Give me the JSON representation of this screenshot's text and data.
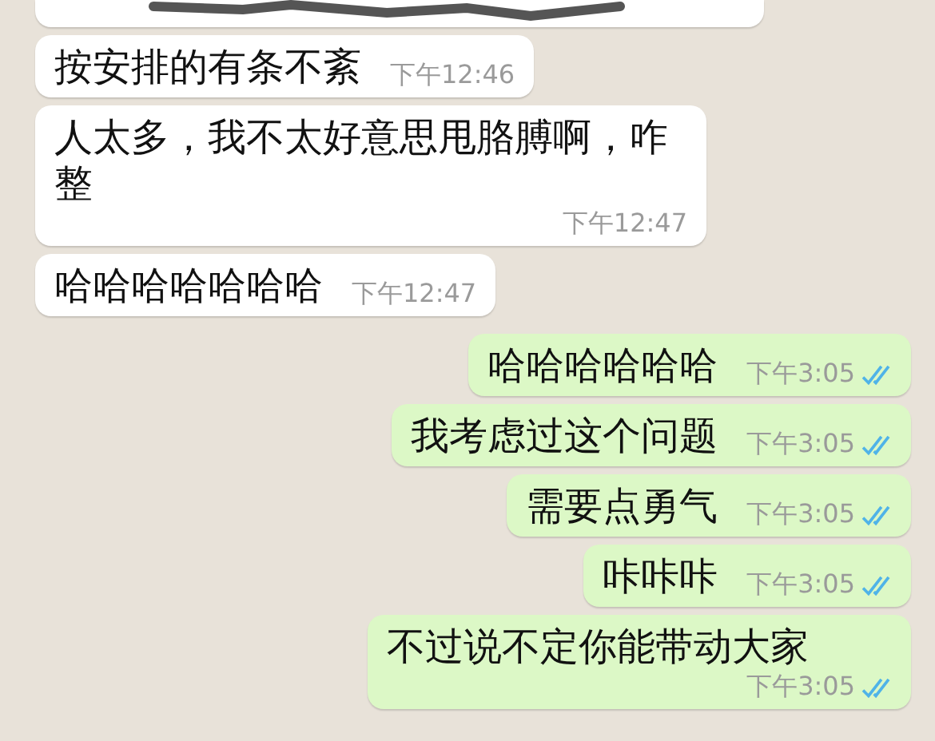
{
  "messages": [
    {
      "kind": "incoming",
      "text": "按安排的有条不紊",
      "time": "下午12:46"
    },
    {
      "kind": "incoming",
      "text": "人太多，我不太好意思甩胳膊啊，咋整",
      "time": "下午12:47"
    },
    {
      "kind": "incoming",
      "text": "哈哈哈哈哈哈哈",
      "time": "下午12:47"
    },
    {
      "kind": "outgoing",
      "text": "哈哈哈哈哈哈",
      "time": "下午3:05",
      "read": true
    },
    {
      "kind": "outgoing",
      "text": "我考虑过这个问题",
      "time": "下午3:05",
      "read": true
    },
    {
      "kind": "outgoing",
      "text": "需要点勇气",
      "time": "下午3:05",
      "read": true
    },
    {
      "kind": "outgoing",
      "text": "咔咔咔",
      "time": "下午3:05",
      "read": true
    },
    {
      "kind": "outgoing",
      "text": "不过说不定你能带动大家",
      "time": "下午3:05",
      "read": true
    }
  ]
}
